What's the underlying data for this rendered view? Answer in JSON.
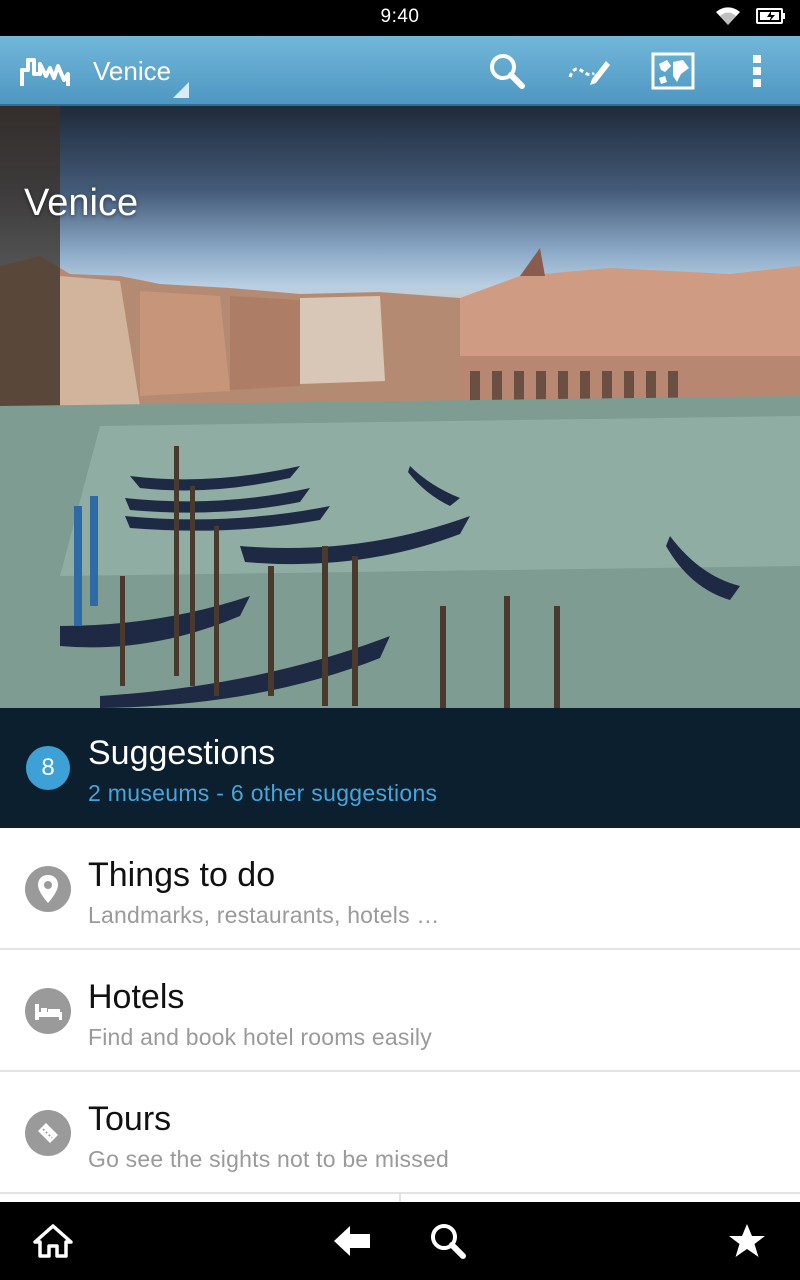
{
  "status_bar": {
    "time": "9:40",
    "icons": [
      "wifi-icon",
      "battery-icon"
    ]
  },
  "action_bar": {
    "title": "Venice",
    "icons": [
      "app-logo-icon",
      "search-icon",
      "edit-itinerary-icon",
      "map-icon",
      "overflow-menu-icon"
    ],
    "background_color": "#5aa6cf"
  },
  "hero": {
    "title": "Venice"
  },
  "suggestions": {
    "badge_count": "8",
    "title": "Suggestions",
    "subtitle": "2 museums - 6 other suggestions",
    "background_color": "#0c1f2e",
    "accent_color": "#45a6db"
  },
  "list": {
    "items": [
      {
        "icon": "map-pin-icon",
        "title": "Things to do",
        "subtitle": "Landmarks, restaurants, hotels …"
      },
      {
        "icon": "bed-icon",
        "title": "Hotels",
        "subtitle": "Find and book hotel rooms easily"
      },
      {
        "icon": "ticket-icon",
        "title": "Tours",
        "subtitle": "Go see the sights not to be missed"
      }
    ]
  },
  "bottom_nav": {
    "icons": [
      "home-icon",
      "back-icon",
      "search-icon",
      "star-icon"
    ]
  }
}
